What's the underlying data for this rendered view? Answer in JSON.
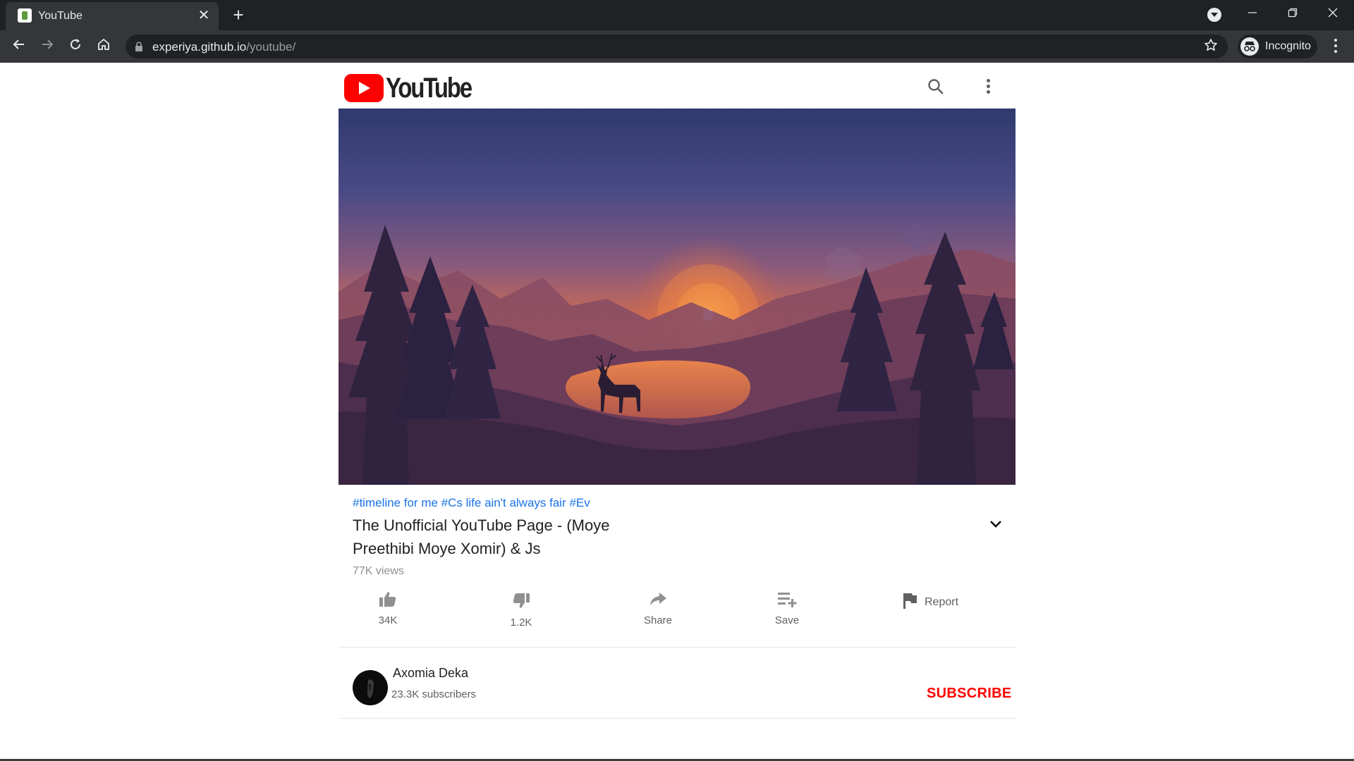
{
  "browser": {
    "tab_title": "YouTube",
    "tab_close": "✕",
    "new_tab": "+",
    "url_domain": "experiya.github.io",
    "url_path": "/youtube/",
    "profile_label": "Incognito",
    "icons": [
      "favicon",
      "close-icon",
      "plus-icon",
      "tab-search-icon",
      "minimize-icon",
      "restore-icon",
      "window-close-icon",
      "back-icon",
      "forward-icon",
      "reload-icon",
      "home-icon",
      "lock-icon",
      "star-icon",
      "incognito-icon",
      "more-vert-icon"
    ]
  },
  "header": {
    "logo_text": "YouTube",
    "icons": [
      "search-icon",
      "more-vert-icon"
    ]
  },
  "video": {
    "hashtags": "#timeline for me #Cs life ain't always fair #Ev",
    "title": "The Unofficial YouTube Page - (Moye Preethibi Moye Xomir) & Js",
    "views": "77K views"
  },
  "actions": {
    "likes": "34K",
    "dislikes": "1.2K",
    "share": "Share",
    "save": "Save",
    "report": "Report"
  },
  "channel": {
    "name": "Axomia Deka",
    "subscribers": "23.3K  subscribers",
    "subscribe_label": "SUBSCRIBE"
  },
  "colors": {
    "brand_red": "#ff0000",
    "link_blue": "#1a73e8",
    "chrome_dark": "#202124",
    "chrome_toolbar": "#35363a"
  }
}
